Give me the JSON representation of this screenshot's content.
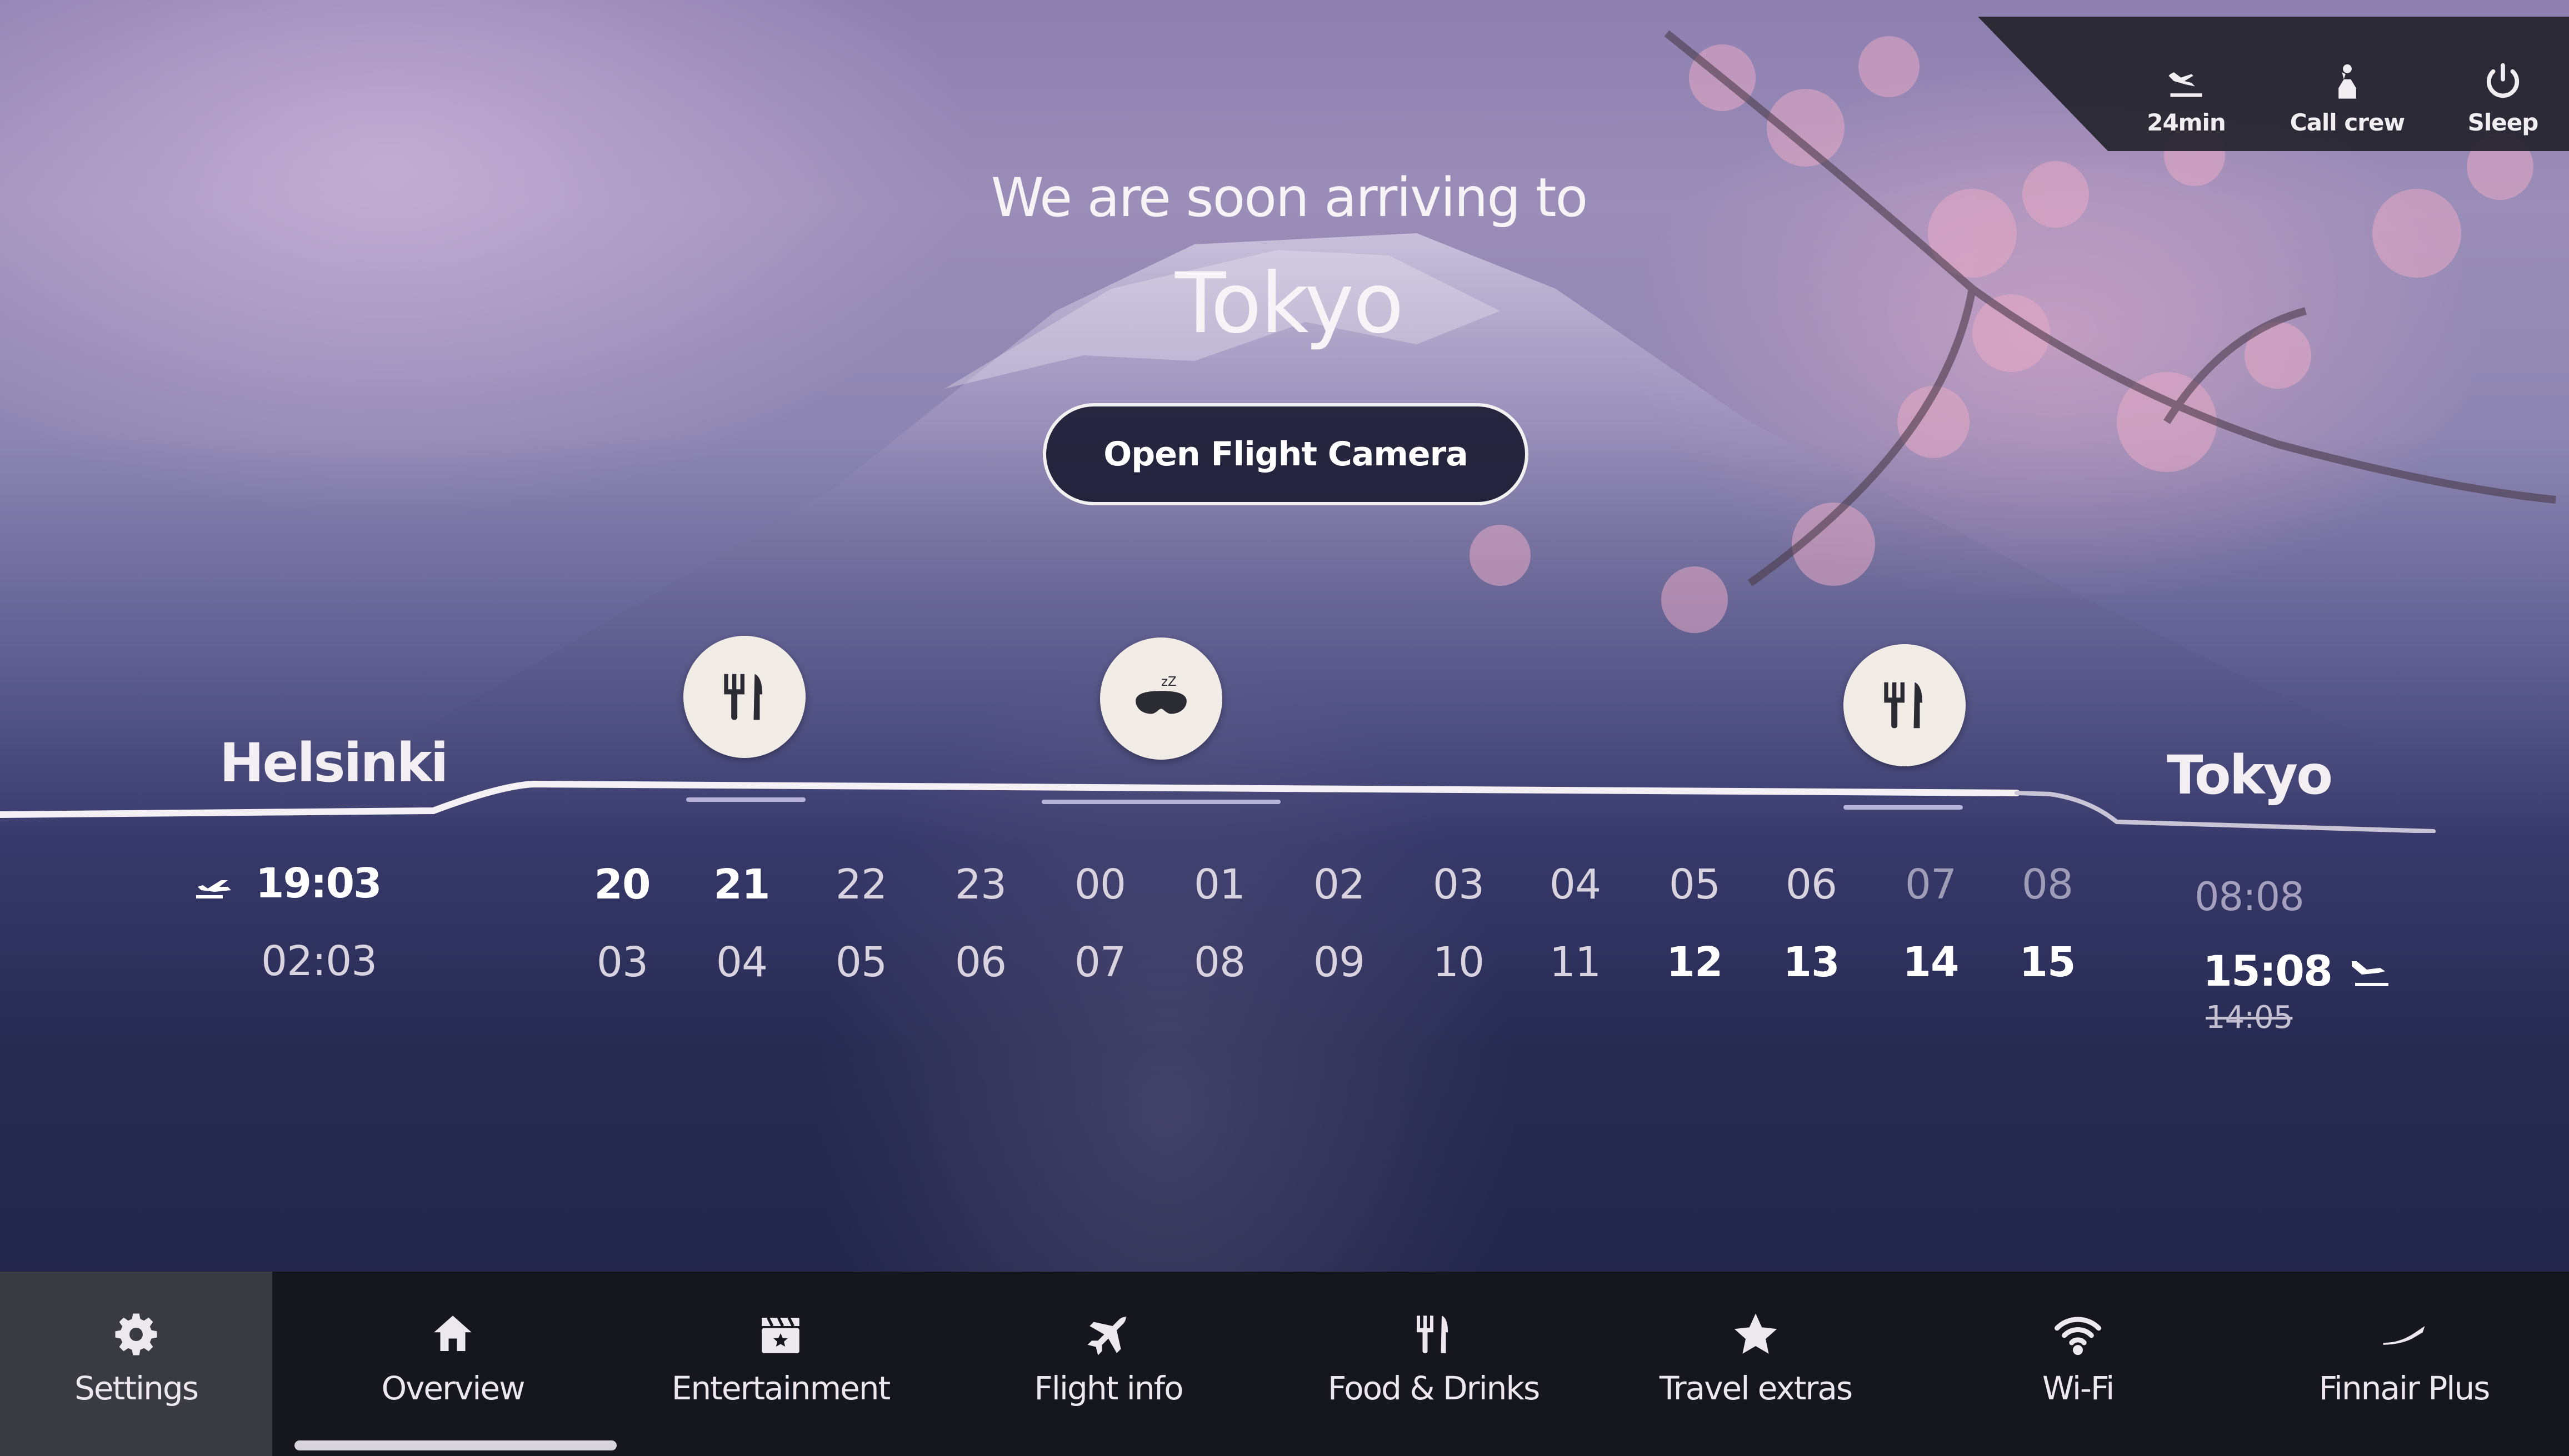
{
  "status_bar": {
    "time_to_landing": {
      "label": "24min",
      "icon": "landing-plane-icon"
    },
    "call_crew": {
      "label": "Call crew",
      "icon": "call-crew-icon"
    },
    "sleep": {
      "label": "Sleep",
      "icon": "power-icon"
    }
  },
  "hero": {
    "intro": "We are soon arriving to",
    "city": "Tokyo",
    "camera_button": "Open Flight Camera"
  },
  "timeline": {
    "origin": "Helsinki",
    "destination": "Tokyo",
    "departure_time_origin": "19:03",
    "departure_time_dest": "02:03",
    "arrival_time_origin": "08:08",
    "arrival_time_dest": "15:08",
    "original_arrival": "14:05",
    "hours_origin": [
      "20",
      "21",
      "22",
      "23",
      "00",
      "01",
      "02",
      "03",
      "04",
      "05",
      "06",
      "07",
      "08"
    ],
    "hours_dest": [
      "03",
      "04",
      "05",
      "06",
      "07",
      "08",
      "09",
      "10",
      "11",
      "12",
      "13",
      "14",
      "15"
    ],
    "events": [
      {
        "type": "meal",
        "icon": "fork-knife-icon"
      },
      {
        "type": "sleep",
        "icon": "sleep-mask-icon"
      },
      {
        "type": "meal",
        "icon": "fork-knife-icon"
      }
    ]
  },
  "nav": {
    "items": [
      {
        "label": "Settings",
        "icon": "gear-icon"
      },
      {
        "label": "Overview",
        "icon": "home-icon"
      },
      {
        "label": "Entertainment",
        "icon": "clapperboard-icon"
      },
      {
        "label": "Flight info",
        "icon": "airplane-icon"
      },
      {
        "label": "Food & Drinks",
        "icon": "fork-knife-icon"
      },
      {
        "label": "Travel extras",
        "icon": "star-icon"
      },
      {
        "label": "Wi-Fi",
        "icon": "wifi-icon"
      },
      {
        "label": "Finnair Plus",
        "icon": "finnair-plus-icon"
      }
    ],
    "active": "Overview"
  }
}
